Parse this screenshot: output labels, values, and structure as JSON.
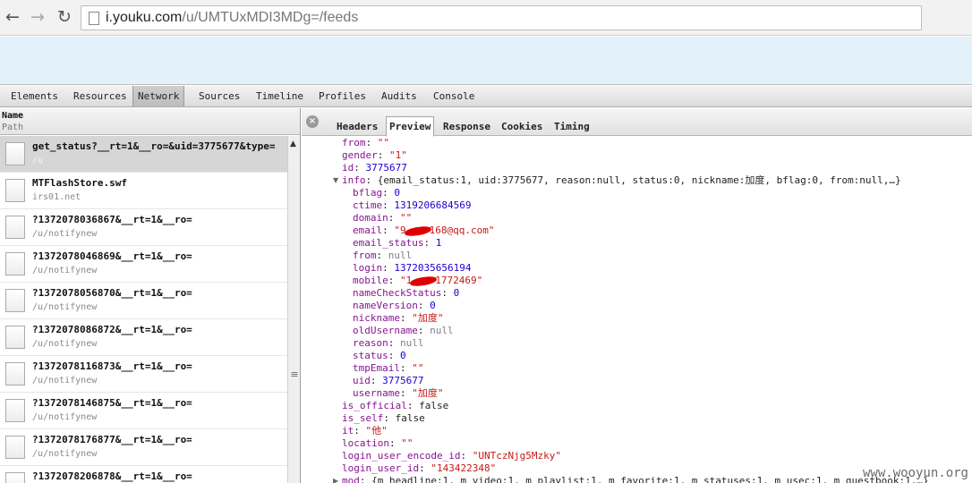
{
  "browser": {
    "back_label": "←",
    "forward_label": "→",
    "reload_label": "↻",
    "url_host": "i.youku.com",
    "url_path": "/u/UMTUxMDI3MDg=/feeds"
  },
  "devtools": {
    "tabs": [
      "Elements",
      "Resources",
      "Network",
      "Sources",
      "Timeline",
      "Profiles",
      "Audits",
      "Console"
    ],
    "selected_tab": "Network"
  },
  "network": {
    "column_name": "Name",
    "column_path": "Path",
    "requests": [
      {
        "name": "get_status?__rt=1&__ro=&uid=3775677&type=",
        "path": "/u"
      },
      {
        "name": "MTFlashStore.swf",
        "path": "irs01.net"
      },
      {
        "name": "?1372078036867&__rt=1&__ro=",
        "path": "/u/notifynew"
      },
      {
        "name": "?1372078046869&__rt=1&__ro=",
        "path": "/u/notifynew"
      },
      {
        "name": "?1372078056870&__rt=1&__ro=",
        "path": "/u/notifynew"
      },
      {
        "name": "?1372078086872&__rt=1&__ro=",
        "path": "/u/notifynew"
      },
      {
        "name": "?1372078116873&__rt=1&__ro=",
        "path": "/u/notifynew"
      },
      {
        "name": "?1372078146875&__rt=1&__ro=",
        "path": "/u/notifynew"
      },
      {
        "name": "?1372078176877&__rt=1&__ro=",
        "path": "/u/notifynew"
      },
      {
        "name": "?1372078206878&__rt=1&__ro=",
        "path": ""
      }
    ],
    "selected_index": 0
  },
  "detail": {
    "tabs": [
      "Headers",
      "Preview",
      "Response",
      "Cookies",
      "Timing"
    ],
    "selected_tab": "Preview",
    "close_label": "×"
  },
  "preview": {
    "from_key": "from",
    "from_val": "\"\"",
    "gender_key": "gender",
    "gender_val": "\"1\"",
    "id_key": "id",
    "id_val": "3775677",
    "info_key": "info",
    "info_summary": "{email_status:1, uid:3775677, reason:null, status:0, nickname:加度, bflag:0, from:null,…}",
    "info": {
      "bflag_key": "bflag",
      "bflag_val": "0",
      "ctime_key": "ctime",
      "ctime_val": "1319206684569",
      "domain_key": "domain",
      "domain_val": "\"\"",
      "email_key": "email",
      "email_pre": "\"9",
      "email_post": "168@qq.com\"",
      "email_status_key": "email_status",
      "email_status_val": "1",
      "from_key": "from",
      "from_val": "null",
      "login_key": "login",
      "login_val": "1372035656194",
      "mobile_key": "mobile",
      "mobile_pre": "\"1",
      "mobile_post": "1772469\"",
      "nameCheckStatus_key": "nameCheckStatus",
      "nameCheckStatus_val": "0",
      "nameVersion_key": "nameVersion",
      "nameVersion_val": "0",
      "nickname_key": "nickname",
      "nickname_val": "\"加度\"",
      "oldUsername_key": "oldUsername",
      "oldUsername_val": "null",
      "reason_key": "reason",
      "reason_val": "null",
      "status_key": "status",
      "status_val": "0",
      "tmpEmail_key": "tmpEmail",
      "tmpEmail_val": "\"\"",
      "uid_key": "uid",
      "uid_val": "3775677",
      "username_key": "username",
      "username_val": "\"加度\""
    },
    "is_official_key": "is_official",
    "is_official_val": "false",
    "is_self_key": "is_self",
    "is_self_val": "false",
    "it_key": "it",
    "it_val": "\"他\"",
    "location_key": "location",
    "location_val": "\"\"",
    "login_user_encode_id_key": "login_user_encode_id",
    "login_user_encode_id_val": "\"UNTczNjg5Mzky\"",
    "login_user_id_key": "login_user_id",
    "login_user_id_val": "\"143422348\"",
    "mod_key": "mod",
    "mod_summary": "{m_headline:1, m_video:1, m_playlist:1, m_favorite:1, m_statuses:1, m_usec:1, m_guestbook:1,…}"
  },
  "watermark": "www.wooyun.org"
}
